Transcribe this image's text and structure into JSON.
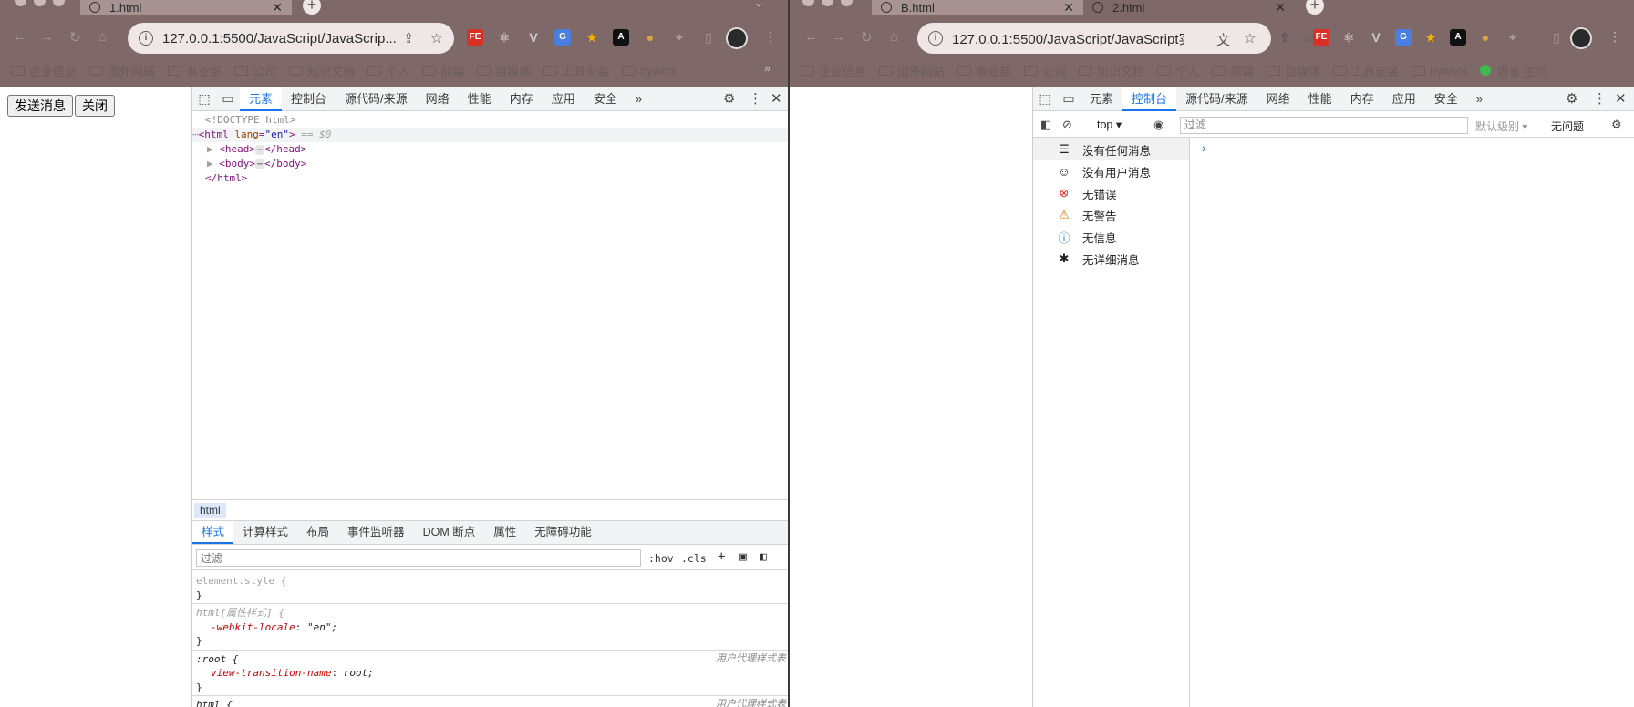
{
  "left_window": {
    "tab": {
      "title": "1.html"
    },
    "address": {
      "url": "127.0.0.1:5500/JavaScript/JavaScrip..."
    },
    "bookmarks": [
      "企业信息",
      "国外网站",
      "事业部",
      "公司",
      "知识文档",
      "个人",
      "前端",
      "自媒体",
      "工具安装",
      "bywork"
    ],
    "bookmarks_more": "»",
    "extension_fe": "FE",
    "page_buttons": {
      "send": "发送消息",
      "close": "关闭"
    },
    "devtools": {
      "tabs": [
        "元素",
        "控制台",
        "源代码/来源",
        "网络",
        "性能",
        "内存",
        "应用",
        "安全"
      ],
      "more_tabs": "»",
      "dom": {
        "doctype": "<!DOCTYPE html>",
        "html_open_tag": "<html",
        "html_attr": "lang",
        "html_attr_value": "\"en\"",
        "html_open_end": ">",
        "html_eq": "== $0",
        "head": "<head>",
        "head_close": "</head>",
        "body": "<body>",
        "body_close": "</body>",
        "html_close": "</html>",
        "ellipsis": "⋯"
      },
      "breadcrumb": "html",
      "style_tabs": [
        "样式",
        "计算样式",
        "布局",
        "事件监听器",
        "DOM 断点",
        "属性",
        "无障碍功能"
      ],
      "filter_placeholder": "过滤",
      "hov": ":hov",
      "cls": ".cls",
      "rules": [
        {
          "selector": "element.style {",
          "lines": [],
          "close": "}",
          "source": ""
        },
        {
          "selector": "html[属性样式] {",
          "lines": [
            {
              "prop": "-webkit-locale",
              "value": "\"en\";"
            }
          ],
          "close": "}",
          "source": ""
        },
        {
          "selector": ":root {",
          "lines": [
            {
              "prop": "view-transition-name",
              "value": "root;"
            }
          ],
          "close": "}",
          "source": "用户代理样式表"
        },
        {
          "selector": "html {",
          "lines": [],
          "close": "",
          "source": "用户代理样式表"
        }
      ]
    }
  },
  "right_window": {
    "tabs": [
      {
        "title": "B.html"
      },
      {
        "title": "2.html"
      }
    ],
    "address": {
      "url": "127.0.0.1:5500/JavaScript/JavaScript实..."
    },
    "bookmarks": [
      "企业信息",
      "国外网站",
      "事业部",
      "公司",
      "知识文档",
      "个人",
      "前端",
      "自媒体",
      "工具安装",
      "bywork"
    ],
    "bookmark_extra": "语雀·主页",
    "extension_fe": "FE",
    "devtools": {
      "tabs": [
        "元素",
        "控制台",
        "源代码/来源",
        "网络",
        "性能",
        "内存",
        "应用",
        "安全"
      ],
      "more_tabs": "»",
      "context": "top",
      "filter_placeholder": "过滤",
      "levels": "默认级别",
      "issues": "无问题",
      "sidebar": [
        {
          "icon": "list",
          "label": "没有任何消息"
        },
        {
          "icon": "user",
          "label": "没有用户消息"
        },
        {
          "icon": "error",
          "label": "无错误"
        },
        {
          "icon": "warning",
          "label": "无警告"
        },
        {
          "icon": "info",
          "label": "无信息"
        },
        {
          "icon": "bug",
          "label": "无详细消息"
        }
      ],
      "prompt": "›"
    }
  },
  "colors": {
    "chrome_bg": "#7e6868",
    "accent": "#1a73e8"
  }
}
